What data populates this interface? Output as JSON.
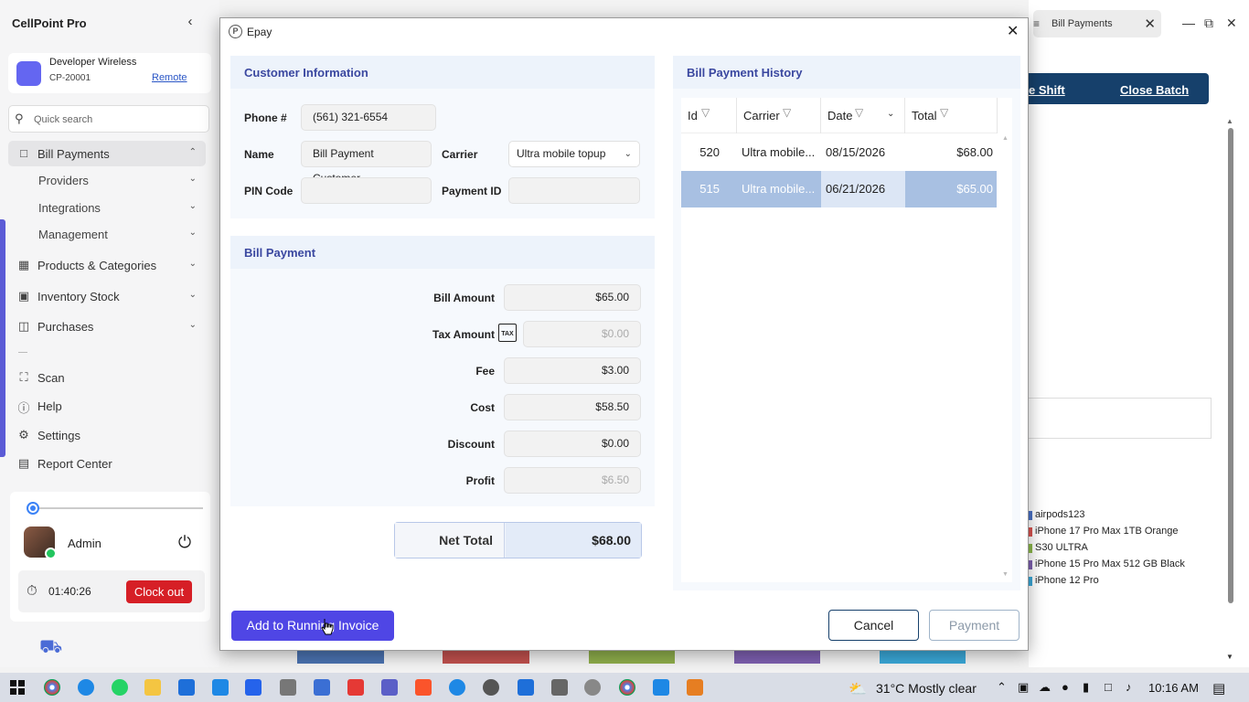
{
  "app": {
    "title": "CellPoint Pro"
  },
  "store": {
    "name": "Developer Wireless",
    "id": "CP-20001",
    "remote_label": "Remote"
  },
  "search": {
    "placeholder": "Quick search"
  },
  "nav": {
    "bill_payments": "Bill Payments",
    "providers": "Providers",
    "integrations": "Integrations",
    "management": "Management",
    "products": "Products & Categories",
    "inventory": "Inventory Stock",
    "purchases": "Purchases",
    "scan": "Scan",
    "help": "Help",
    "settings": "Settings",
    "report_center": "Report Center"
  },
  "user": {
    "name": "Admin",
    "timer": "01:40:26",
    "clock_out_label": "Clock out"
  },
  "background": {
    "tab_label": "Bill Payments",
    "shift_label": "e Shift",
    "close_batch_label": "Close Batch",
    "legend": [
      {
        "label": "airpods123",
        "color": "#4a72c8"
      },
      {
        "label": "iPhone 17 Pro Max 1TB Orange",
        "color": "#d9534f"
      },
      {
        "label": "S30 ULTRA",
        "color": "#8bb84a"
      },
      {
        "label": "iPhone 15 Pro Max 512 GB Black",
        "color": "#7d5fb0"
      },
      {
        "label": "iPhone 12 Pro",
        "color": "#3aa8d8"
      }
    ]
  },
  "modal": {
    "title": "Epay",
    "customer_info": {
      "header": "Customer Information",
      "phone_label": "Phone #",
      "phone_value": "(561) 321-6554",
      "name_label": "Name",
      "name_value": "Bill Payment Customer",
      "carrier_label": "Carrier",
      "carrier_value": "Ultra mobile topup",
      "pin_label": "PIN Code",
      "pin_value": "",
      "payment_id_label": "Payment ID",
      "payment_id_value": ""
    },
    "bill_payment": {
      "header": "Bill Payment",
      "bill_amount_label": "Bill Amount",
      "bill_amount": "$65.00",
      "tax_amount_label": "Tax Amount",
      "tax_amount": "$0.00",
      "tax_icon_text": "TAX",
      "fee_label": "Fee",
      "fee": "$3.00",
      "cost_label": "Cost",
      "cost": "$58.50",
      "discount_label": "Discount",
      "discount": "$0.00",
      "profit_label": "Profit",
      "profit": "$6.50",
      "net_total_label": "Net Total",
      "net_total": "$68.00"
    },
    "history": {
      "header": "Bill Payment History",
      "columns": {
        "id": "Id",
        "carrier": "Carrier",
        "date": "Date",
        "total": "Total"
      },
      "rows": [
        {
          "id": "520",
          "carrier": "Ultra mobile...",
          "date": "08/15/2026",
          "total": "$68.00",
          "selected": false
        },
        {
          "id": "515",
          "carrier": "Ultra mobile...",
          "date": "06/21/2026",
          "total": "$65.00",
          "selected": true
        }
      ]
    },
    "buttons": {
      "add_invoice": "Add to Running Invoice",
      "cancel": "Cancel",
      "payment": "Payment"
    }
  },
  "taskbar": {
    "weather": "31°C  Mostly clear",
    "time": "10:16 AM"
  },
  "colors": {
    "accent": "#4f46e5",
    "brand_dark": "#16406b",
    "danger": "#d61f26",
    "section_header": "#3b48a0"
  }
}
